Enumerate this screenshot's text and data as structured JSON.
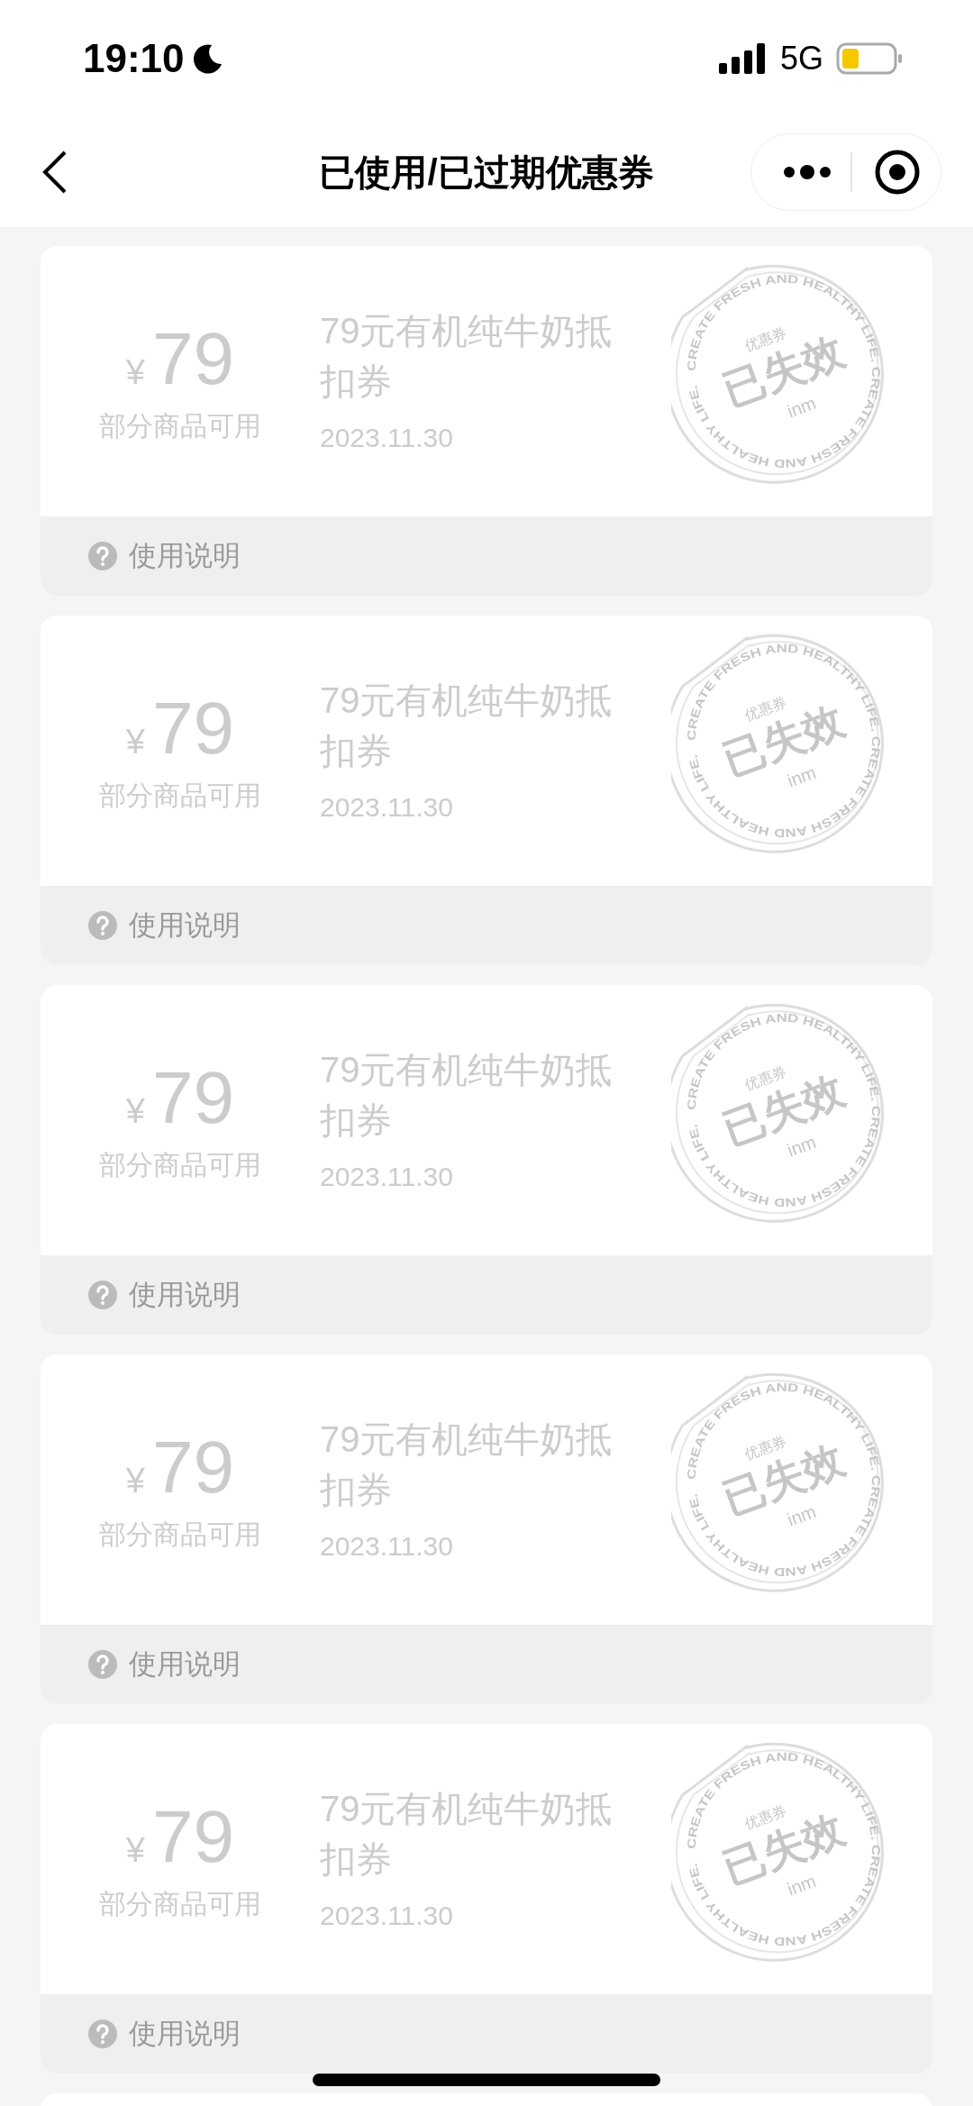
{
  "status_bar": {
    "time": "19:10",
    "network": "5G"
  },
  "header": {
    "title": "已使用/已过期优惠券"
  },
  "coupons": [
    {
      "currency": "¥",
      "amount": "79",
      "scope": "部分商品可用",
      "title": "79元有机纯牛奶抵扣券",
      "date": "2023.11.30",
      "stamp": {
        "ring_text": "CREATE FRESH AND HEALTHY LIFE. CREATE FRESH AND HEALTHY LIFE.",
        "label": "优惠券",
        "status": "已失效",
        "brand": "inm"
      },
      "footer": "使用说明"
    },
    {
      "currency": "¥",
      "amount": "79",
      "scope": "部分商品可用",
      "title": "79元有机纯牛奶抵扣券",
      "date": "2023.11.30",
      "stamp": {
        "ring_text": "CREATE FRESH AND HEALTHY LIFE. CREATE FRESH AND HEALTHY LIFE.",
        "label": "优惠券",
        "status": "已失效",
        "brand": "inm"
      },
      "footer": "使用说明"
    },
    {
      "currency": "¥",
      "amount": "79",
      "scope": "部分商品可用",
      "title": "79元有机纯牛奶抵扣券",
      "date": "2023.11.30",
      "stamp": {
        "ring_text": "CREATE FRESH AND HEALTHY LIFE. CREATE FRESH AND HEALTHY LIFE.",
        "label": "优惠券",
        "status": "已失效",
        "brand": "inm"
      },
      "footer": "使用说明"
    },
    {
      "currency": "¥",
      "amount": "79",
      "scope": "部分商品可用",
      "title": "79元有机纯牛奶抵扣券",
      "date": "2023.11.30",
      "stamp": {
        "ring_text": "CREATE FRESH AND HEALTHY LIFE. CREATE FRESH AND HEALTHY LIFE.",
        "label": "优惠券",
        "status": "已失效",
        "brand": "inm"
      },
      "footer": "使用说明"
    },
    {
      "currency": "¥",
      "amount": "79",
      "scope": "部分商品可用",
      "title": "79元有机纯牛奶抵扣券",
      "date": "2023.11.30",
      "stamp": {
        "ring_text": "CREATE FRESH AND HEALTHY LIFE. CREATE FRESH AND HEALTHY LIFE.",
        "label": "优惠券",
        "status": "已失效",
        "brand": "inm"
      },
      "footer": "使用说明"
    }
  ]
}
